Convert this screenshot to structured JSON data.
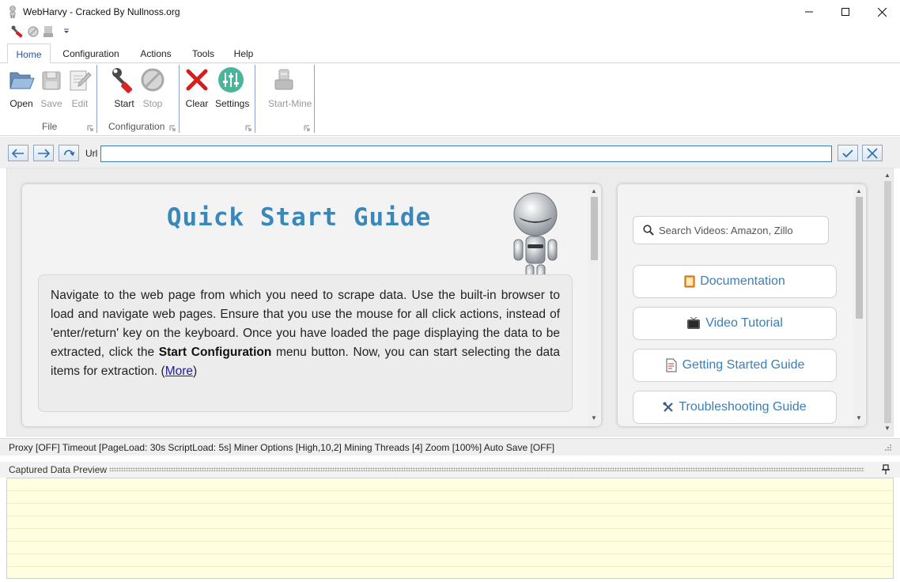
{
  "window": {
    "title": "WebHarvy - Cracked By Nullnoss.org",
    "controls": {
      "minimize": "minimize",
      "maximize": "maximize",
      "close": "close"
    }
  },
  "ribbon": {
    "tabs": [
      {
        "label": "Home",
        "active": true
      },
      {
        "label": "Configuration"
      },
      {
        "label": "Actions"
      },
      {
        "label": "Tools"
      },
      {
        "label": "Help"
      }
    ],
    "groups": {
      "file": {
        "label": "File",
        "buttons": [
          {
            "label": "Open",
            "icon": "folder-open-icon",
            "enabled": true
          },
          {
            "label": "Save",
            "icon": "floppy-icon",
            "enabled": false
          },
          {
            "label": "Edit",
            "icon": "edit-icon",
            "enabled": false
          }
        ]
      },
      "configuration": {
        "label": "Configuration",
        "buttons": [
          {
            "label": "Start",
            "icon": "wrench-icon",
            "enabled": true
          },
          {
            "label": "Stop",
            "icon": "stop-icon",
            "enabled": false
          }
        ]
      },
      "misc": {
        "buttons": [
          {
            "label": "Clear",
            "icon": "red-x-icon",
            "enabled": true
          },
          {
            "label": "Settings",
            "icon": "sliders-icon",
            "enabled": true
          }
        ]
      },
      "mine": {
        "buttons": [
          {
            "label": "Start-Mine",
            "icon": "miner-icon",
            "enabled": false
          }
        ]
      }
    }
  },
  "navbar": {
    "url_label": "Url",
    "url_value": ""
  },
  "guide": {
    "title": "Quick Start Guide",
    "paragraph": {
      "part1": "Navigate to the web page from which you need to scrape data. Use the built-in browser to load and navigate web pages. Ensure that you use the mouse for all click actions, instead of 'enter/return' key on the keyboard. Once you have loaded the page displaying the data to be extracted, click the ",
      "bold1": "Start Configuration",
      "part2": " menu button. Now, you can start selecting the data items for extraction.  (",
      "more": "More",
      "part3": ")"
    }
  },
  "resources": {
    "search_placeholder": "Search Videos: Amazon, Zillo",
    "links": [
      {
        "label": "Documentation",
        "icon": "book-icon"
      },
      {
        "label": "Video Tutorial",
        "icon": "tv-icon"
      },
      {
        "label": "Getting Started Guide",
        "icon": "document-icon"
      },
      {
        "label": "Troubleshooting Guide",
        "icon": "tools-icon"
      }
    ]
  },
  "status": {
    "text": "Proxy [OFF] Timeout [PageLoad: 30s ScriptLoad: 5s] Miner Options [High,10,2] Mining Threads [4] Zoom [100%] Auto Save [OFF]"
  },
  "preview": {
    "title": "Captured Data Preview"
  }
}
